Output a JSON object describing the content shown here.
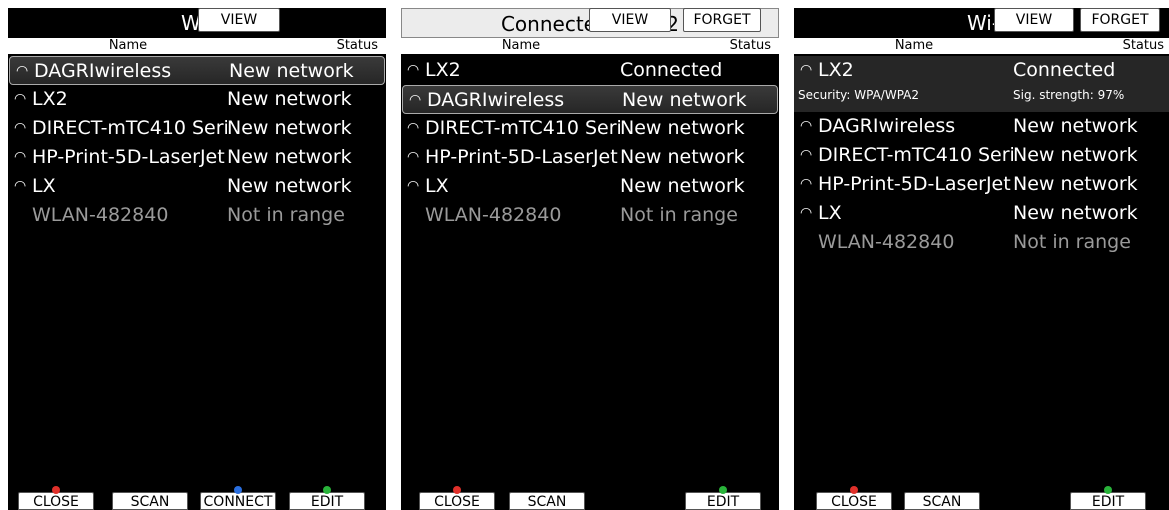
{
  "panels": [
    {
      "title": "Wi-",
      "top_buttons": [
        "VIEW"
      ],
      "header": {
        "name": "Name",
        "status": "Status"
      },
      "rows": [
        {
          "name": "DAGRIwireless",
          "status": "New network",
          "icon": "wifi-icon",
          "selected": true
        },
        {
          "name": "LX2",
          "status": "New network",
          "icon": "wifi-icon"
        },
        {
          "name": "DIRECT-mTC410 Seri",
          "status": "New network",
          "icon": "wifi-icon"
        },
        {
          "name": "HP-Print-5D-LaserJet",
          "status": "New network",
          "icon": "wifi-icon"
        },
        {
          "name": "LX",
          "status": "New network",
          "icon": "wifi-icon"
        },
        {
          "name": "WLAN-482840",
          "status": "Not in range",
          "dim": true
        }
      ],
      "bottom_buttons": [
        {
          "label": "CLOSE",
          "dot": "red"
        },
        {
          "label": "SCAN"
        },
        {
          "label": "CONNECT",
          "dot": "blue"
        },
        {
          "label": "EDIT",
          "dot": "green"
        }
      ]
    },
    {
      "title": "Connected to LX2",
      "top_buttons": [
        "VIEW",
        "FORGET"
      ],
      "header": {
        "name": "Name",
        "status": "Status"
      },
      "rows": [
        {
          "name": "LX2",
          "status": "Connected",
          "icon": "wifi-icon"
        },
        {
          "name": "DAGRIwireless",
          "status": "New network",
          "icon": "wifi-icon",
          "selected": true
        },
        {
          "name": "DIRECT-mTC410 Seri",
          "status": "New network",
          "icon": "wifi-icon"
        },
        {
          "name": "HP-Print-5D-LaserJet",
          "status": "New network",
          "icon": "wifi-icon"
        },
        {
          "name": "LX",
          "status": "New network",
          "icon": "wifi-icon"
        },
        {
          "name": "WLAN-482840",
          "status": "Not in range",
          "dim": true
        }
      ],
      "bottom_buttons": [
        {
          "label": "CLOSE",
          "dot": "red"
        },
        {
          "label": "SCAN"
        },
        {
          "label": "EDIT",
          "dot": "green"
        }
      ]
    },
    {
      "title": "Wi-",
      "top_buttons": [
        "VIEW",
        "FORGET"
      ],
      "header": {
        "name": "Name",
        "status": "Status"
      },
      "rows": [
        {
          "name": "LX2",
          "status": "Connected",
          "icon": "wifi-icon",
          "expanded": true,
          "security": "Security: WPA/WPA2",
          "strength": "Sig. strength: 97%"
        },
        {
          "name": "DAGRIwireless",
          "status": "New network",
          "icon": "wifi-icon"
        },
        {
          "name": "DIRECT-mTC410 Seri",
          "status": "New network",
          "icon": "wifi-icon"
        },
        {
          "name": "HP-Print-5D-LaserJet",
          "status": "New network",
          "icon": "wifi-icon"
        },
        {
          "name": "LX",
          "status": "New network",
          "icon": "wifi-icon"
        },
        {
          "name": "WLAN-482840",
          "status": "Not in range",
          "dim": true
        }
      ],
      "bottom_buttons": [
        {
          "label": "CLOSE",
          "dot": "red"
        },
        {
          "label": "SCAN"
        },
        {
          "label": "EDIT",
          "dot": "green"
        }
      ]
    }
  ],
  "colors": {
    "background": "#000000",
    "text": "#ffffff",
    "dim": "#9a9a9a",
    "close_dot": "#e0302a",
    "connect_dot": "#2a6fe0",
    "edit_dot": "#29b33a"
  }
}
